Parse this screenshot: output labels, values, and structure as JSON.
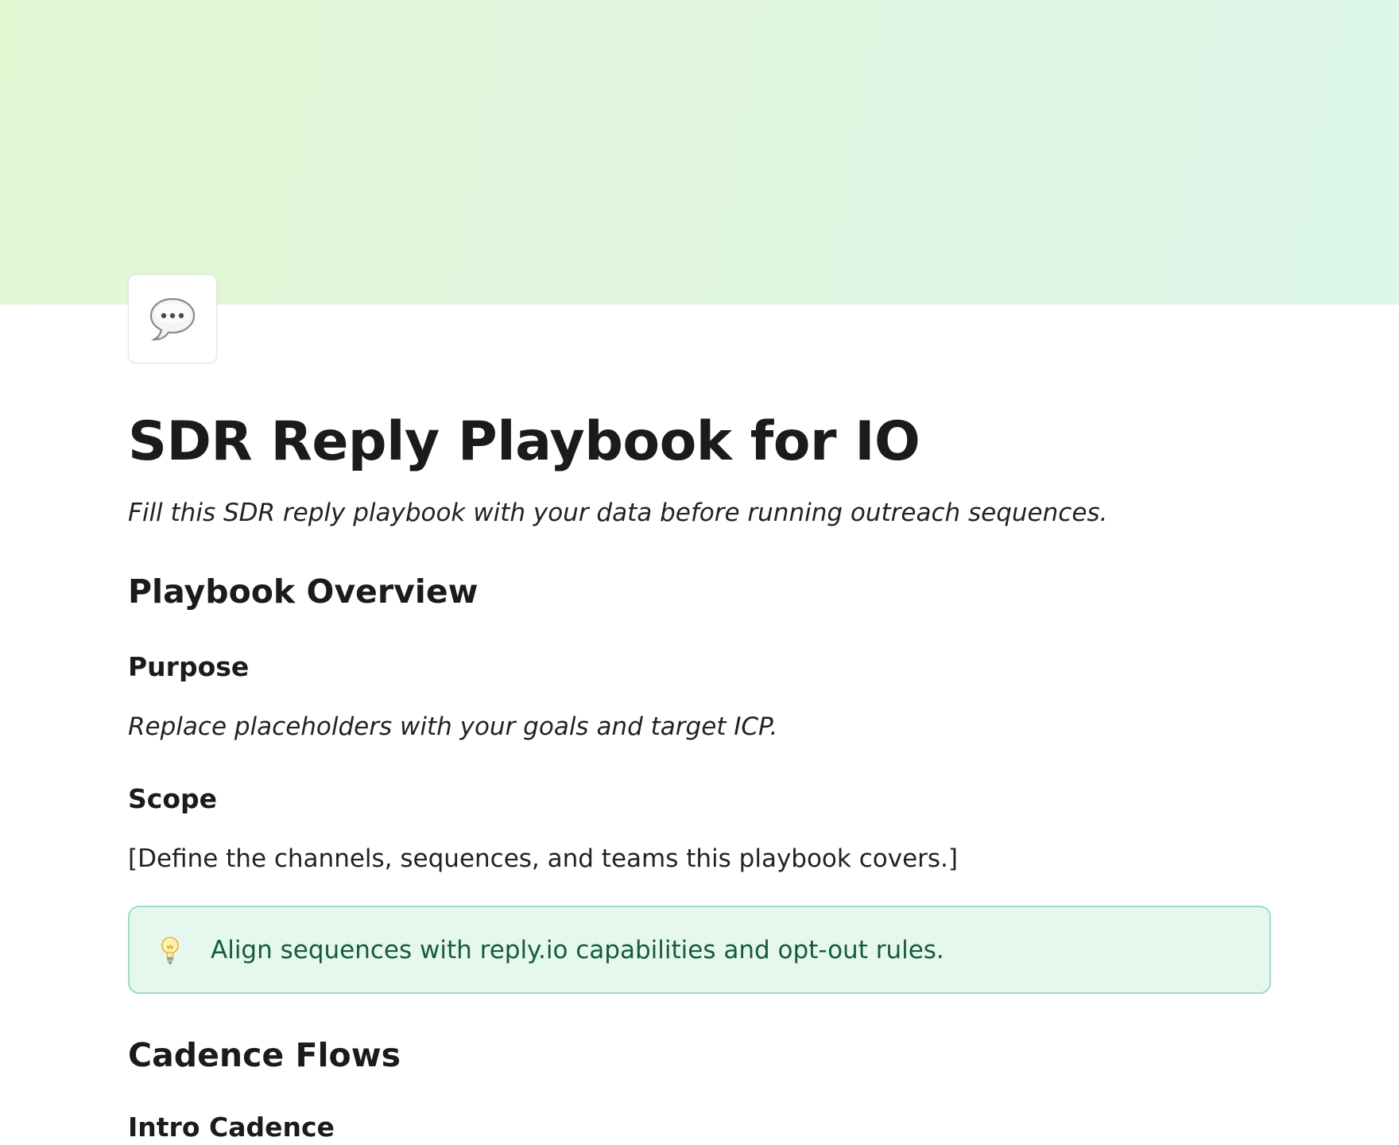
{
  "cover": {
    "gradient_start": "#e4f7d3",
    "gradient_end": "#dcf6ea"
  },
  "page_icon": {
    "icon": "speech-balloon-icon"
  },
  "document": {
    "title": "SDR Reply Playbook for IO",
    "subtitle": "Fill this SDR reply playbook with your data before running outreach sequences."
  },
  "sections": {
    "overview": {
      "heading": "Playbook Overview",
      "purpose": {
        "heading": "Purpose",
        "text": "Replace placeholders with your goals and target ICP."
      },
      "scope": {
        "heading": "Scope",
        "text": "[Define the channels, sequences, and teams this playbook covers.]"
      },
      "callout": {
        "icon": "light-bulb-icon",
        "text": "Align sequences with reply.io capabilities and opt-out rules.",
        "background": "#e6f7ee",
        "border": "#9fdcc0",
        "text_color": "#145c3c"
      }
    },
    "cadence": {
      "heading": "Cadence Flows",
      "intro": {
        "heading": "Intro Cadence"
      }
    }
  }
}
